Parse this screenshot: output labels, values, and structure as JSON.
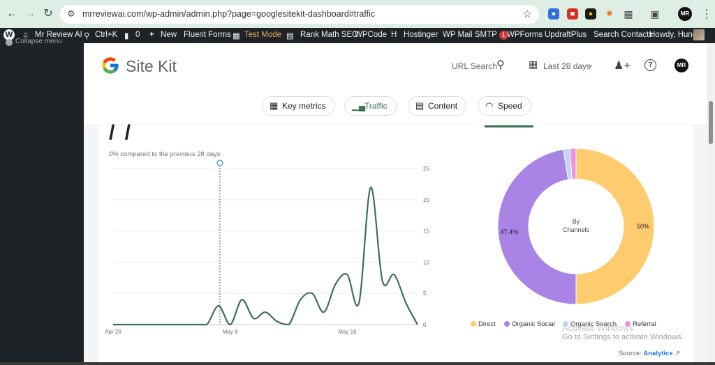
{
  "browser": {
    "url": "mrreviewai.com/wp-admin/admin.php?page=googlesitekit-dashboard#traffic",
    "profile_initials": "MR"
  },
  "adminbar": {
    "site_name": "Mr Review AI",
    "shortcut": "Ctrl+K",
    "comments_count": "0",
    "new_label": "New",
    "fluent_forms": "Fluent Forms",
    "test_mode": "Test Mode",
    "rank_math": "Rank Math SEO",
    "wpcode": "WPCode",
    "hostinger": "Hostinger",
    "wp_mail_smtp": "WP Mail SMTP",
    "wp_mail_badge": "1",
    "wpforms": "WPForms",
    "updraft": "UpdraftPlus",
    "search_contacts": "Search Contacts",
    "howdy": "Howdy, Hung"
  },
  "sidebar": {
    "collapse_label": "Collapse menu"
  },
  "header": {
    "brand": "Site Kit",
    "url_search": "URL Search",
    "date_range": "Last 28 days",
    "user_initials": "MR"
  },
  "tabs": [
    {
      "label": "Key metrics",
      "icon": "grid-icon"
    },
    {
      "label": "Traffic",
      "icon": "bar-chart-icon",
      "active": true
    },
    {
      "label": "Content",
      "icon": "content-icon"
    },
    {
      "label": "Speed",
      "icon": "speedometer-icon"
    }
  ],
  "card": {
    "compare_text": "0% compared to the previous 28 days",
    "source_label": "Source:",
    "source_link": "Analytics"
  },
  "chart_data": [
    {
      "type": "line",
      "x": [
        "Apr 28",
        "Apr 29",
        "Apr 30",
        "May 1",
        "May 2",
        "May 3",
        "May 4",
        "May 5",
        "May 6",
        "May 7",
        "May 8",
        "May 9",
        "May 10",
        "May 11",
        "May 12",
        "May 13",
        "May 14",
        "May 15",
        "May 16",
        "May 17",
        "May 18",
        "May 19",
        "May 20",
        "May 21",
        "May 22",
        "May 23"
      ],
      "series": [
        {
          "values": [
            0,
            0,
            0,
            0,
            0,
            0,
            0,
            0,
            0,
            3,
            0,
            4,
            1,
            2,
            0.5,
            0,
            4,
            5,
            2,
            6.5,
            8,
            3.5,
            22,
            7,
            8,
            3.5,
            0
          ]
        }
      ],
      "x_ticks": [
        "Apr 28",
        "May 8",
        "May 18"
      ],
      "y_ticks": [
        0,
        5,
        10,
        15,
        20,
        25
      ],
      "ylim": [
        0,
        25
      ],
      "color": "#3c7251",
      "marker_date": "May 7"
    },
    {
      "type": "pie",
      "center_label": "By Channels",
      "slices": [
        {
          "name": "Direct",
          "value": 50,
          "label": "50%",
          "color": "#fecb6e"
        },
        {
          "name": "Organic Social",
          "value": 47.4,
          "label": "47.4%",
          "color": "#a983e6"
        },
        {
          "name": "Organic Search",
          "value": 1.3,
          "label": "",
          "color": "#bed4ff"
        },
        {
          "name": "Referral",
          "value": 1.3,
          "label": "",
          "color": "#ee92da"
        }
      ]
    }
  ],
  "watermark": {
    "title": "Activate Windows",
    "subtitle": "Go to Settings to activate Windows."
  }
}
